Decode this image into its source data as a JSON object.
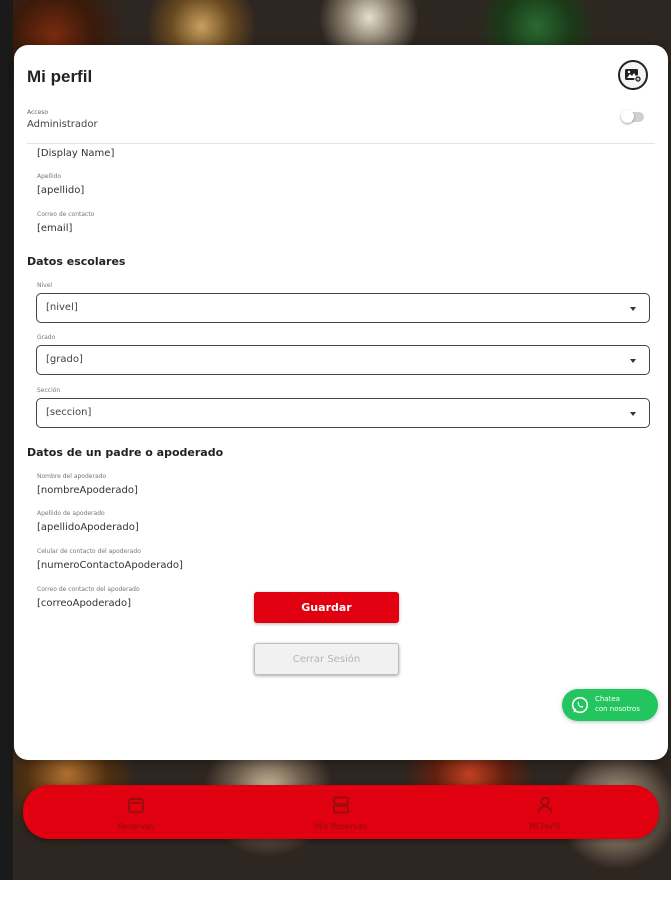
{
  "colors": {
    "brand_red": "#e0000f",
    "whatsapp_green": "#22c55e"
  },
  "header": {
    "title": "Mi perfil",
    "avatar_icon": "image-edit-icon"
  },
  "access": {
    "label": "Acceso",
    "value": "Administrador",
    "toggle_on": false
  },
  "personal": {
    "display_name": "[Display Name]",
    "last_name_label": "Apellido",
    "last_name": "[apellido]",
    "email_label": "Correo de contacto",
    "email": "[email]"
  },
  "school": {
    "section_title": "Datos escolares",
    "level_label": "Nivel",
    "level_value": "[nivel]",
    "grade_label": "Grado",
    "grade_value": "[grado]",
    "section_label": "Sección",
    "section_value": "[seccion]"
  },
  "guardian": {
    "section_title": "Datos de un padre o apoderado",
    "name_label": "Nombre del apoderado",
    "name_value": "[nombreApoderado]",
    "last_name_label": "Apellido de apoderado",
    "last_name_value": "[apellidoApoderado]",
    "phone_label": "Celular de contacto del apoderado",
    "phone_value": "[numeroContactoApoderado]",
    "email_label": "Correo de contacto del apoderado",
    "email_value": "[correoApoderado]"
  },
  "actions": {
    "save_label": "Guardar",
    "logout_label": "Cerrar Sesión"
  },
  "whatsapp": {
    "line1": "Chatea",
    "line2": "con nosotros",
    "icon": "whatsapp-icon"
  },
  "bottom_nav": {
    "items": [
      {
        "label": "Reservas",
        "icon": "calendar-icon"
      },
      {
        "label": "Mis Reservas",
        "icon": "list-icon"
      },
      {
        "label": "Mi Perfil",
        "icon": "user-icon"
      }
    ]
  }
}
